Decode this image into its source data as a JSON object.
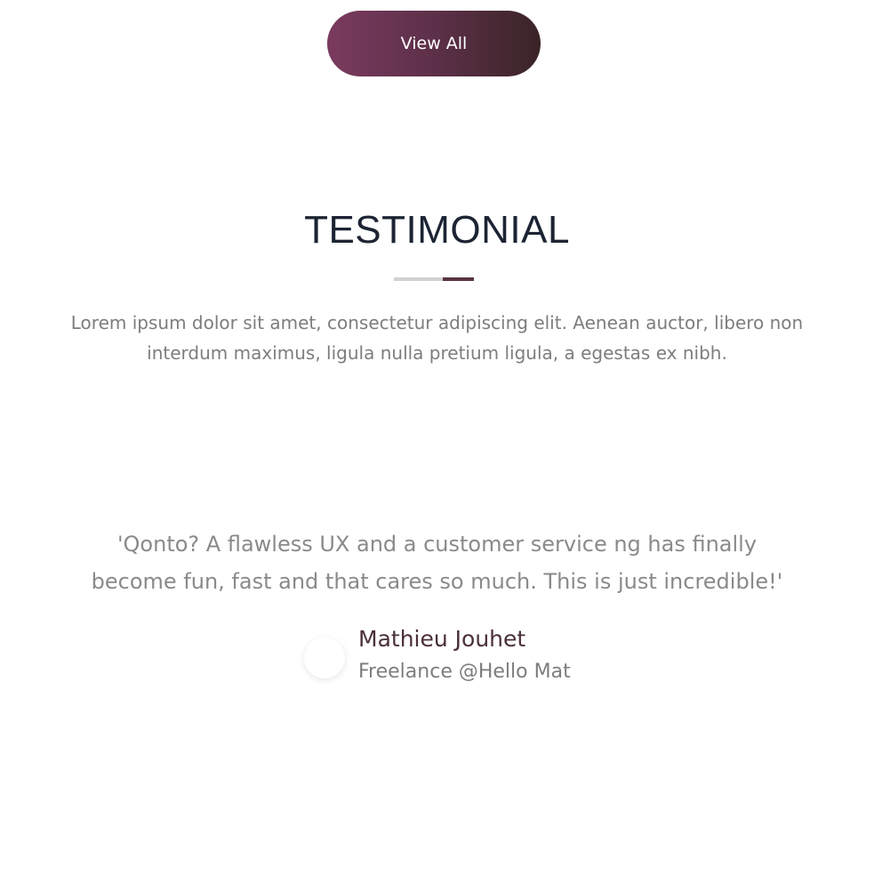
{
  "header": {
    "view_all_label": "View All"
  },
  "testimonial_section": {
    "title": "TESTIMONIAL",
    "intro": "Lorem ipsum dolor sit amet, consectetur adipiscing elit. Aenean auctor, libero non interdum maximus, ligula nulla pretium ligula, a egestas ex nibh.",
    "quote": "'Qonto? A flawless UX and a customer service ng has finally become fun, fast and that cares so much. This is just incredible!'",
    "author": {
      "name": "Mathieu Jouhet",
      "role": "Freelance @Hello Mat"
    }
  },
  "colors": {
    "button_gradient_start": "#7a3a5e",
    "button_gradient_end": "#3a2427",
    "title": "#1c2434",
    "accent": "#5a3344",
    "divider_light": "#d4d0d2",
    "body_text": "#7d7d7d"
  }
}
